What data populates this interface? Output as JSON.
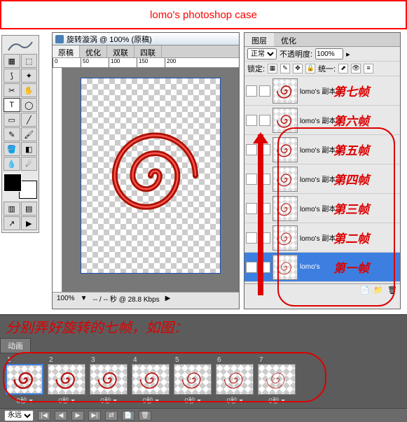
{
  "banner": {
    "title": "lomo's photoshop case"
  },
  "document": {
    "title": "旋转漩涡 @ 100% (原稿)",
    "tabs": [
      "原稿",
      "优化",
      "双联",
      "四联"
    ],
    "active_tab": 0,
    "ruler_marks": [
      "0",
      "50",
      "100",
      "150",
      "200"
    ],
    "status": {
      "zoom": "100%",
      "time": "-- / -- 秒 @ 28.8 Kbps"
    }
  },
  "layers_panel": {
    "tabs": [
      "图层",
      "优化"
    ],
    "active_tab": 0,
    "blend_mode": "正常",
    "opacity_label": "不透明度:",
    "opacity_value": "100%",
    "lock_label": "锁定:",
    "unify_label": "统一:",
    "layers": [
      {
        "name": "lomo's 副本 6",
        "anno": "第七帧"
      },
      {
        "name": "lomo's 副本 5",
        "anno": "第六帧"
      },
      {
        "name": "lomo's 副本 4",
        "anno": "第五帧"
      },
      {
        "name": "lomo's 副本 3",
        "anno": "第四帧"
      },
      {
        "name": "lomo's 副本 2",
        "anno": "第三帧"
      },
      {
        "name": "lomo's 副本",
        "anno": "第二帧"
      },
      {
        "name": "lomo's",
        "anno": "第一帧",
        "selected": true
      }
    ]
  },
  "caption": "分别弄好旋转的七帧，如图：",
  "animation": {
    "tab": "动画",
    "frames": [
      {
        "n": "1",
        "delay": "0秒",
        "selected": true
      },
      {
        "n": "2",
        "delay": "0秒"
      },
      {
        "n": "3",
        "delay": "0秒"
      },
      {
        "n": "4",
        "delay": "0秒"
      },
      {
        "n": "5",
        "delay": "0秒"
      },
      {
        "n": "6",
        "delay": "0秒"
      },
      {
        "n": "7",
        "delay": "0秒"
      }
    ],
    "loop": "永远"
  }
}
